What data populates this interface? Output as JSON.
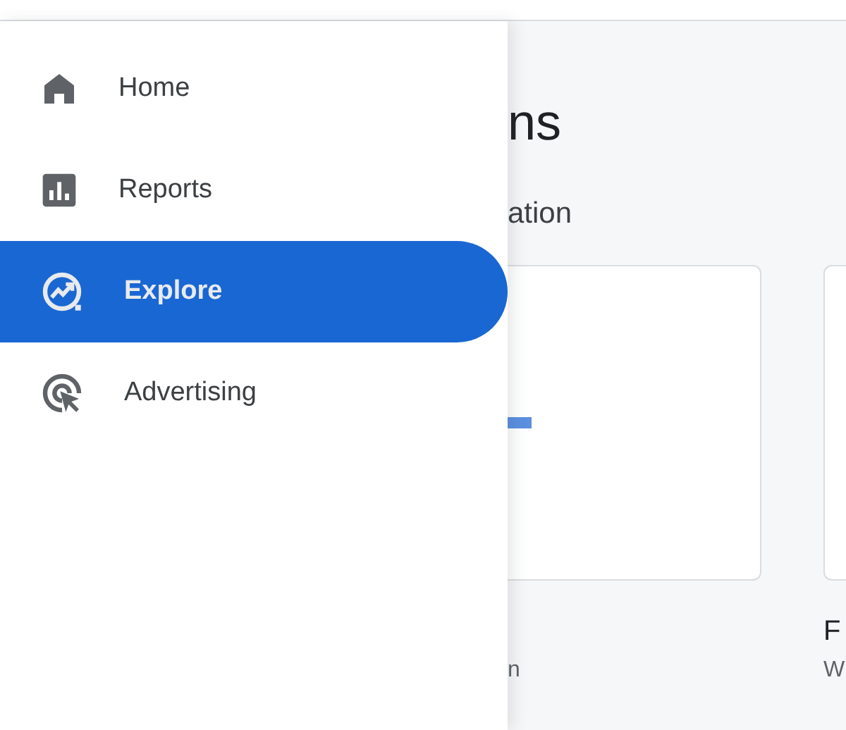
{
  "nav": {
    "items": [
      {
        "label": "Home",
        "selected": false
      },
      {
        "label": "Reports",
        "selected": false
      },
      {
        "label": "Explore",
        "selected": true
      },
      {
        "label": "Advertising",
        "selected": false
      }
    ]
  },
  "content": {
    "title": "ns",
    "subtitle": "ation",
    "cards": [
      {
        "description": "n"
      },
      {
        "title": "F",
        "description": "W"
      }
    ]
  }
}
